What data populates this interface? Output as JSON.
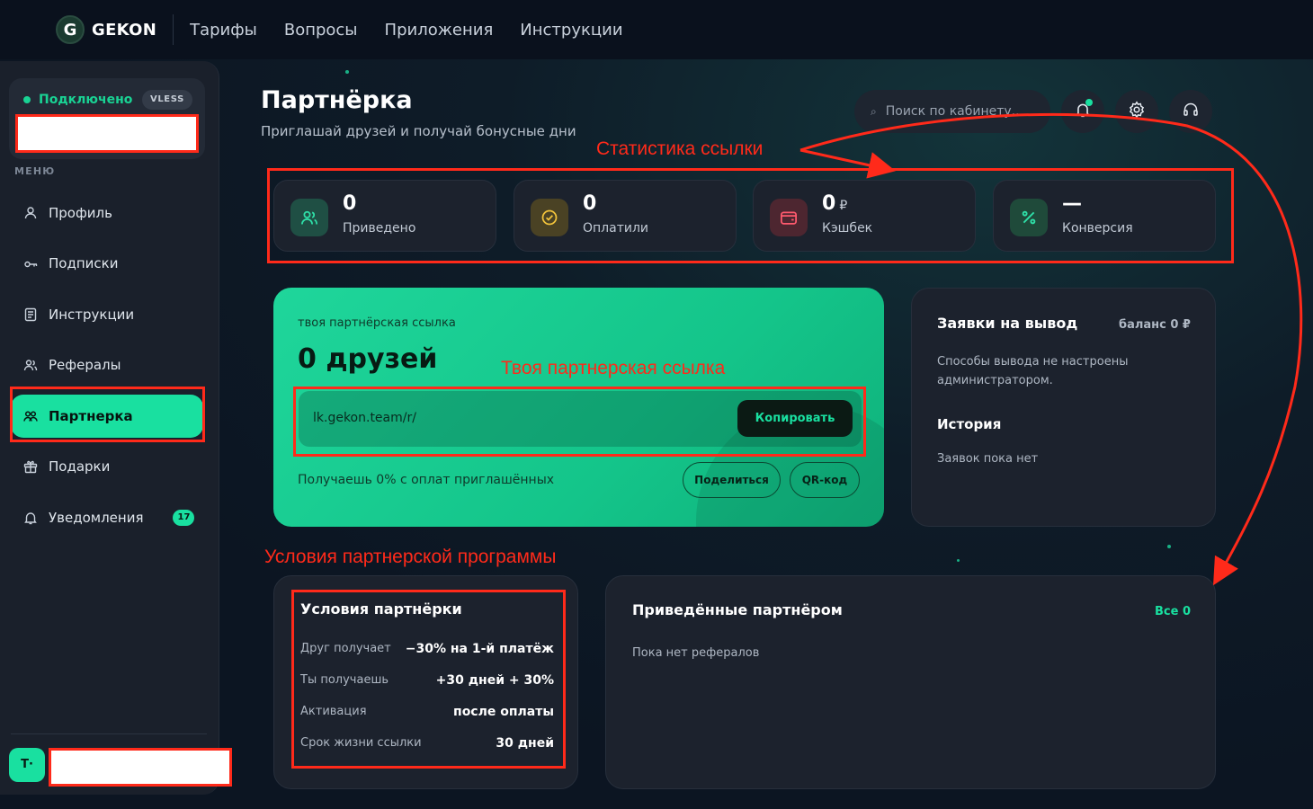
{
  "topbar": {
    "logo_letter": "G",
    "brand": "GEKON",
    "nav": [
      "Тарифы",
      "Вопросы",
      "Приложения",
      "Инструкции"
    ]
  },
  "sidebar": {
    "status_label": "Подключено",
    "protocol_badge": "VLESS",
    "menu_caption": "МЕНЮ",
    "items": [
      {
        "label": "Профиль",
        "icon": "user-icon"
      },
      {
        "label": "Подписки",
        "icon": "key-icon"
      },
      {
        "label": "Инструкции",
        "icon": "document-icon"
      },
      {
        "label": "Рефералы",
        "icon": "users-icon"
      },
      {
        "label": "Партнерка",
        "icon": "partners-icon",
        "active": true
      },
      {
        "label": "Подарки",
        "icon": "gift-icon"
      },
      {
        "label": "Уведомления",
        "icon": "bell-icon",
        "count": "17"
      }
    ],
    "avatar_initials": "T·"
  },
  "header": {
    "title": "Партнёрка",
    "subtitle": "Приглашай друзей и получай бонусные дни",
    "search_placeholder": "Поиск по кабинету..."
  },
  "stats": [
    {
      "value": "0",
      "label": "Приведено",
      "icon": "users-icon",
      "tint": "#1f6b55"
    },
    {
      "value": "0",
      "label": "Оплатили",
      "icon": "check-circle-icon",
      "tint": "#5a4a1f"
    },
    {
      "value": "0",
      "currency": "₽",
      "label": "Кэшбек",
      "icon": "wallet-icon",
      "tint": "#5a2a33"
    },
    {
      "value": "—",
      "label": "Конверсия",
      "icon": "percent-icon",
      "tint": "#1f4a3a"
    }
  ],
  "referral": {
    "caption": "твоя партнёрская ссылка",
    "title": "0 друзей",
    "link": "lk.gekon.team/r/",
    "copy_label": "Копировать",
    "note": "Получаешь 0% с оплат приглашённых",
    "share_label": "Поделиться",
    "qr_label": "QR-код"
  },
  "withdraw": {
    "title": "Заявки на вывод",
    "balance": "баланс 0 ₽",
    "text": "Способы вывода не настроены администратором.",
    "history_title": "История",
    "history_empty": "Заявок пока нет"
  },
  "conditions": {
    "title": "Условия партнёрки",
    "rows": [
      {
        "key": "Друг получает",
        "value": "−30% на 1-й платёж"
      },
      {
        "key": "Ты получаешь",
        "value": "+30 дней + 30%"
      },
      {
        "key": "Активация",
        "value": "после оплаты"
      },
      {
        "key": "Срок жизни ссылки",
        "value": "30 дней"
      }
    ]
  },
  "referred": {
    "title": "Приведённые партнёром",
    "all_label": "Все 0",
    "empty": "Пока нет рефералов"
  },
  "annotations": {
    "stats": "Статистика ссылки",
    "link": "Твоя партнерская ссылка",
    "terms": "Условия партнерской программы"
  },
  "colors": {
    "accent": "#19e0a0",
    "annotation": "#ff2a1a"
  }
}
